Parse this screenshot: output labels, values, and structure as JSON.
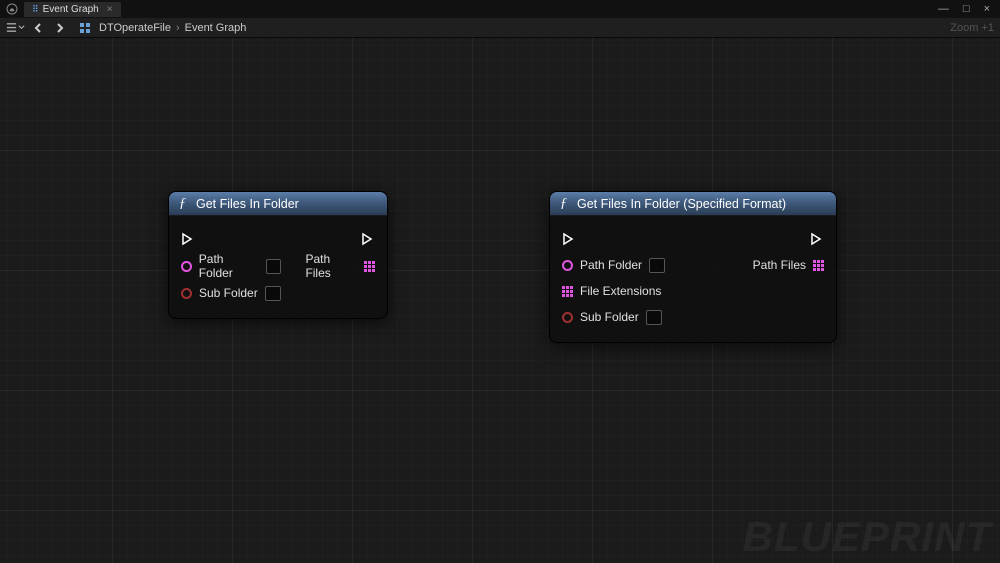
{
  "titlebar": {
    "tab_label": "Event Graph",
    "window_min": "—",
    "window_max": "□",
    "window_close": "×"
  },
  "toolbar": {
    "breadcrumb_root": "DTOperateFile",
    "breadcrumb_sep": "›",
    "breadcrumb_leaf": "Event Graph",
    "zoom_label": "Zoom +1"
  },
  "watermark": "BLUEPRINT",
  "nodes": {
    "n1": {
      "title": "Get Files In Folder",
      "in_path": "Path Folder",
      "in_sub": "Sub Folder",
      "out_files": "Path Files"
    },
    "n2": {
      "title": "Get Files In Folder (Specified Format)",
      "in_path": "Path Folder",
      "in_ext": "File Extensions",
      "in_sub": "Sub Folder",
      "out_files": "Path Files"
    }
  }
}
